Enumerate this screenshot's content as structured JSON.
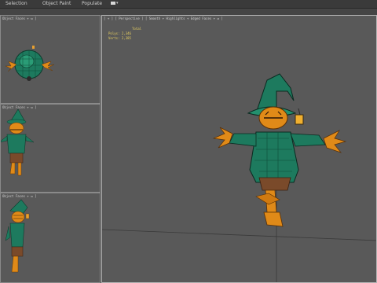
{
  "menubar": {
    "items": [
      {
        "label": "Selection"
      },
      {
        "label": "Object Paint"
      },
      {
        "label": "Populate"
      }
    ],
    "icons": {
      "display": "display-icon",
      "caret": "dropdown-caret-icon"
    }
  },
  "viewports": {
    "top": {
      "label": "Object Faces + ᴍ ]"
    },
    "front": {
      "label": "Object Faces + ᴍ ]"
    },
    "left": {
      "label": "Object Faces + ᴍ ]"
    },
    "perspective": {
      "label": "[ + ] [ Perspective ] [ Smooth + Highlights + Edged Faces + ᴍ ]"
    }
  },
  "stats": {
    "title": "Total",
    "polys_label": "Polys:",
    "polys_value": "2,346",
    "verts_label": "Verts:",
    "verts_value": "2,385"
  },
  "colors": {
    "accent_green": "#1f8a6a",
    "accent_orange": "#e08a18",
    "stats_yellow": "#e8d060",
    "viewport_bg": "#595959"
  }
}
